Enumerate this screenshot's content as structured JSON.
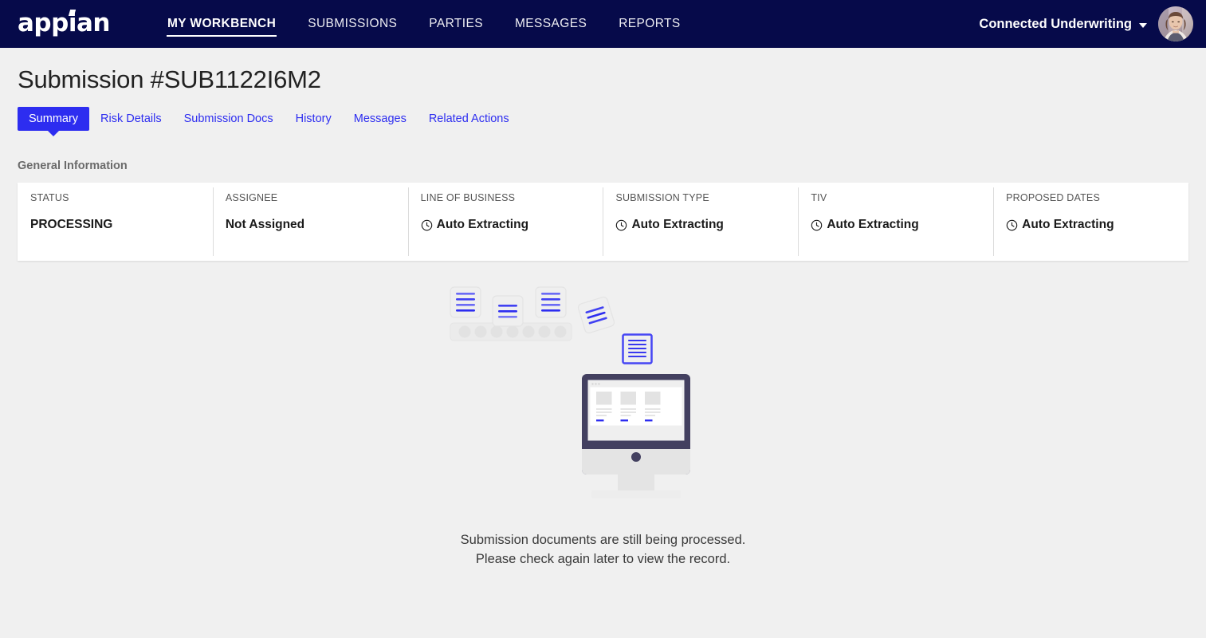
{
  "topbar": {
    "logo_text": "appian",
    "logo_icon": "appian-logo",
    "nav_items": [
      {
        "label": "MY WORKBENCH",
        "active": true
      },
      {
        "label": "SUBMISSIONS",
        "active": false
      },
      {
        "label": "PARTIES",
        "active": false
      },
      {
        "label": "MESSAGES",
        "active": false
      },
      {
        "label": "REPORTS",
        "active": false
      }
    ],
    "tenant_label": "Connected Underwriting",
    "tenant_caret_icon": "chevron-down-icon",
    "avatar_icon": "user-avatar-photo",
    "background_color": "#060a4a"
  },
  "page": {
    "title": "Submission #SUB1122I6M2",
    "background_color": "#f0f0f0"
  },
  "tabs": {
    "accent_color": "#2d2df0",
    "items": [
      {
        "label": "Summary",
        "active": true
      },
      {
        "label": "Risk Details",
        "active": false
      },
      {
        "label": "Submission Docs",
        "active": false
      },
      {
        "label": "History",
        "active": false
      },
      {
        "label": "Messages",
        "active": false
      },
      {
        "label": "Related Actions",
        "active": false
      }
    ]
  },
  "general_information": {
    "heading": "General Information",
    "cells": [
      {
        "label": "STATUS",
        "value": "PROCESSING",
        "icon": null
      },
      {
        "label": "ASSIGNEE",
        "value": "Not Assigned",
        "icon": null
      },
      {
        "label": "LINE OF BUSINESS",
        "value": "Auto Extracting",
        "icon": "clock-icon"
      },
      {
        "label": "SUBMISSION TYPE",
        "value": "Auto Extracting",
        "icon": "clock-icon"
      },
      {
        "label": "TIV",
        "value": "Auto Extracting",
        "icon": "clock-icon"
      },
      {
        "label": "PROPOSED DATES",
        "value": "Auto Extracting",
        "icon": "clock-icon"
      }
    ]
  },
  "empty_state": {
    "illustration_name": "documents-processing-illustration",
    "line1": "Submission documents are still being processed.",
    "line2": "Please check again later to view the record.",
    "accent_color": "#2d2df0",
    "monitor_color": "#434060"
  }
}
